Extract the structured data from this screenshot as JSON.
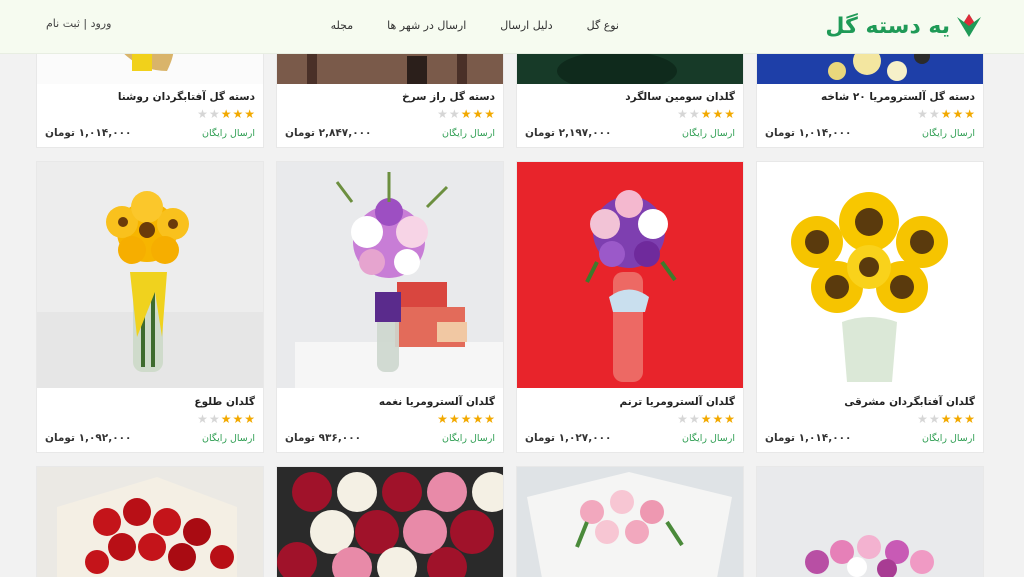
{
  "header": {
    "logo_text": "یه دسته گل",
    "nav": [
      "نوع گل",
      "دلیل ارسال",
      "ارسال در شهر ها",
      "مجله"
    ],
    "auth": "ورود | ثبت نام"
  },
  "products": [
    {
      "title": "دسته گل آفتابگردان روشنا",
      "shipping": "ارسال رایگان",
      "price": "۱,۰۱۴,۰۰۰ تومان",
      "rating": 3
    },
    {
      "title": "دسته گل راز سرخ",
      "shipping": "ارسال رایگان",
      "price": "۲,۸۴۷,۰۰۰ تومان",
      "rating": 3
    },
    {
      "title": "گلدان سومین سالگرد",
      "shipping": "ارسال رایگان",
      "price": "۲,۱۹۷,۰۰۰ تومان",
      "rating": 3
    },
    {
      "title": "دسته گل آلسترومریا ۲۰ شاخه",
      "shipping": "ارسال رایگان",
      "price": "۱,۰۱۴,۰۰۰ تومان",
      "rating": 3
    },
    {
      "title": "گلدان طلوع",
      "shipping": "ارسال رایگان",
      "price": "۱,۰۹۲,۰۰۰ تومان",
      "rating": 3
    },
    {
      "title": "گلدان آلسترومریا نغمه",
      "shipping": "ارسال رایگان",
      "price": "۹۳۶,۰۰۰ تومان",
      "rating": 5
    },
    {
      "title": "گلدان آلسترومریا ترنم",
      "shipping": "ارسال رایگان",
      "price": "۱,۰۲۷,۰۰۰ تومان",
      "rating": 3
    },
    {
      "title": "گلدان آفتابگردان مشرقی",
      "shipping": "ارسال رایگان",
      "price": "۱,۰۱۴,۰۰۰ تومان",
      "rating": 3
    }
  ],
  "colors": {
    "brand": "#1f9a57",
    "star": "#f2a900",
    "shipping": "#2e9e52"
  }
}
